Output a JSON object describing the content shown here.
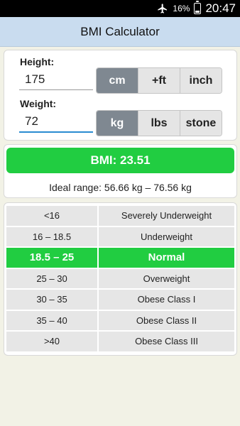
{
  "status_bar": {
    "battery_percent": "16%",
    "time": "20:47",
    "airplane_mode": true
  },
  "app_bar": {
    "title": "BMI Calculator"
  },
  "height": {
    "label": "Height:",
    "value": "175",
    "units": [
      {
        "label": "cm",
        "active": true
      },
      {
        "label": "+ft",
        "active": false
      },
      {
        "label": "inch",
        "active": false
      }
    ]
  },
  "weight": {
    "label": "Weight:",
    "value": "72",
    "units": [
      {
        "label": "kg",
        "active": true
      },
      {
        "label": "lbs",
        "active": false
      },
      {
        "label": "stone",
        "active": false
      }
    ]
  },
  "result": {
    "bmi_text": "BMI: 23.51",
    "ideal_range": "Ideal range: 56.66 kg – 76.56 kg"
  },
  "categories": [
    {
      "range": "<16",
      "label": "Severely Underweight",
      "current": false
    },
    {
      "range": "16 – 18.5",
      "label": "Underweight",
      "current": false
    },
    {
      "range": "18.5 – 25",
      "label": "Normal",
      "current": true
    },
    {
      "range": "25 – 30",
      "label": "Overweight",
      "current": false
    },
    {
      "range": "30 – 35",
      "label": "Obese Class I",
      "current": false
    },
    {
      "range": "35 – 40",
      "label": "Obese Class II",
      "current": false
    },
    {
      "range": ">40",
      "label": "Obese Class III",
      "current": false
    }
  ],
  "colors": {
    "accent_green": "#21cd41",
    "active_unit": "#7f8891",
    "app_bar": "#c9dcef"
  }
}
